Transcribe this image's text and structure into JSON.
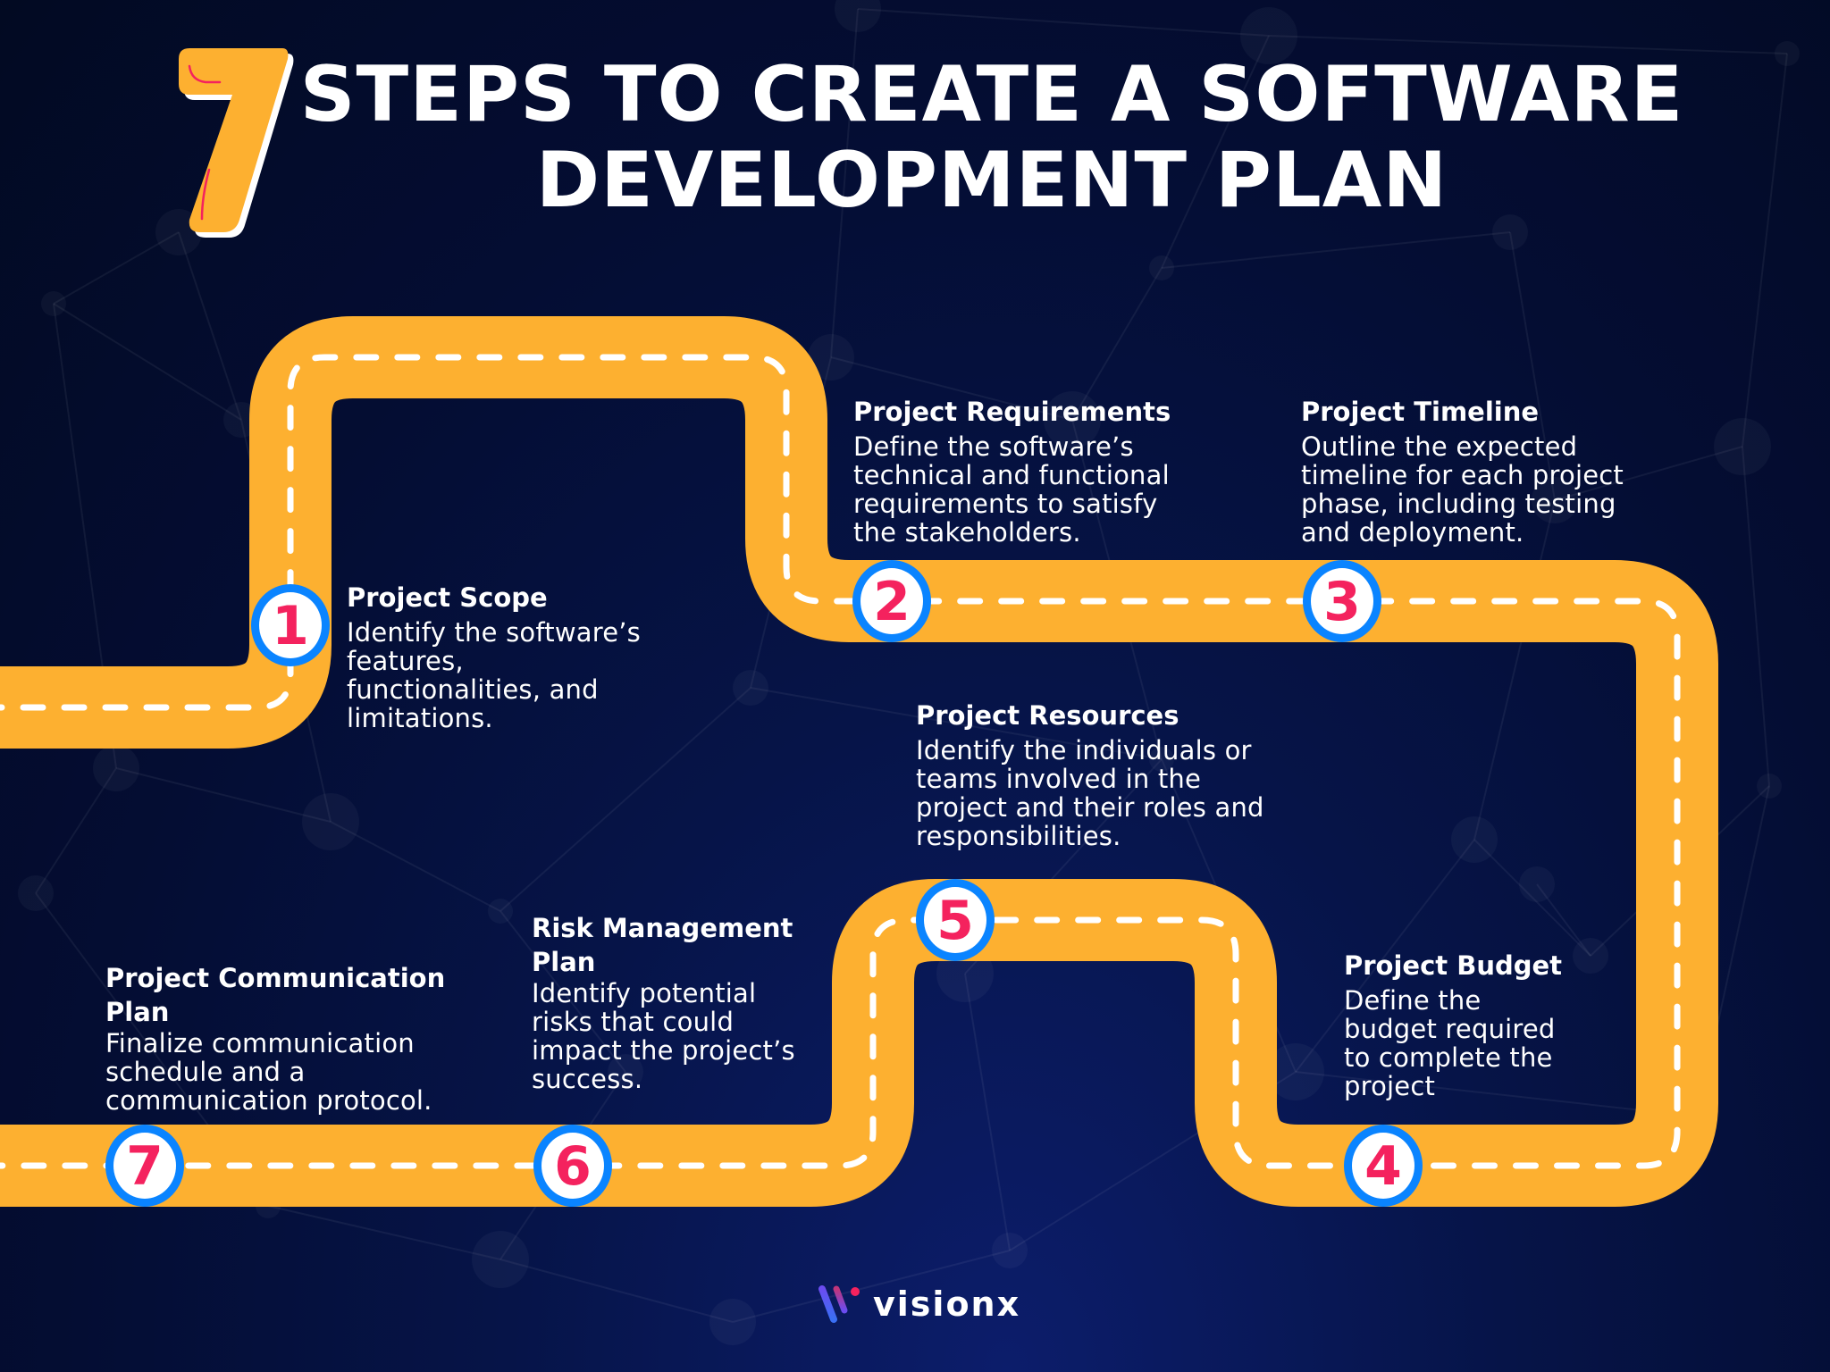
{
  "header": {
    "number": "7",
    "title_line1": "STEPS TO CREATE A SOFTWARE",
    "title_line2": "DEVELOPMENT PLAN"
  },
  "colors": {
    "road": "#FDB030",
    "dash": "#FFFFFF",
    "marker_ring": "#0A84FF",
    "marker_fill": "#FFFFFF",
    "marker_number": "#F4225E",
    "seven_fill": "#FDB030",
    "seven_accent": "#F4225E"
  },
  "steps": [
    {
      "number": "1",
      "title": "Project Scope",
      "description_lines": [
        "Identify the software’s",
        "features,",
        "functionalities, and",
        "limitations."
      ]
    },
    {
      "number": "2",
      "title": "Project Requirements",
      "description_lines": [
        "Define the software’s",
        "technical and functional",
        "requirements to satisfy",
        "the stakeholders."
      ]
    },
    {
      "number": "3",
      "title": "Project Timeline",
      "description_lines": [
        "Outline the expected",
        "timeline for each project",
        "phase, including testing",
        "and deployment."
      ]
    },
    {
      "number": "4",
      "title": "Project Budget",
      "description_lines": [
        "Define the",
        "budget required",
        "to complete the",
        "project"
      ]
    },
    {
      "number": "5",
      "title": "Project Resources",
      "description_lines": [
        "Identify the individuals or",
        "teams involved in the",
        "project and their roles and",
        "responsibilities."
      ]
    },
    {
      "number": "6",
      "title_lines": [
        "Risk Management",
        "Plan"
      ],
      "description_lines": [
        "Identify potential",
        "risks that could",
        "impact the project’s",
        "success."
      ]
    },
    {
      "number": "7",
      "title_lines": [
        "Project Communication",
        "Plan"
      ],
      "description_lines": [
        "Finalize communication",
        "schedule and a",
        "communication protocol."
      ]
    }
  ],
  "footer": {
    "brand": "visionx",
    "logo_icon": "visionx-logo-icon"
  }
}
